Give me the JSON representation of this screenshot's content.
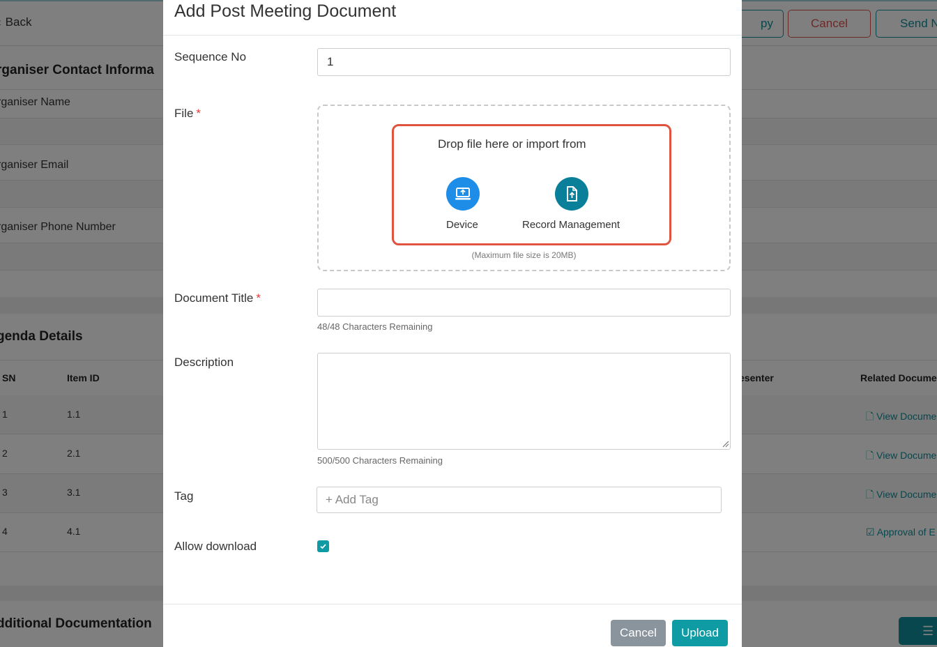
{
  "background": {
    "back_label": "Back",
    "top_buttons": {
      "copy": "py",
      "cancel": "Cancel",
      "send": "Send N"
    },
    "organiser": {
      "section_title": "rganiser Contact Informa",
      "name_label": "rganiser Name",
      "email_label": "rganiser Email",
      "phone_label": "rganiser Phone Number"
    },
    "agenda": {
      "section_title": "genda Details",
      "columns": {
        "sn": "SN",
        "item_id": "Item ID",
        "presenter": "esenter",
        "related_docs": "Related Docume"
      },
      "rows": [
        {
          "sn": "1",
          "item_id": "1.1",
          "doc": "View Docume"
        },
        {
          "sn": "2",
          "item_id": "2.1",
          "doc": "View Docume"
        },
        {
          "sn": "3",
          "item_id": "3.1",
          "doc": "View Docume"
        },
        {
          "sn": "4",
          "item_id": "4.1",
          "doc": "Approval of E"
        }
      ]
    },
    "additional_title": "dditional Documentation"
  },
  "modal": {
    "title": "Add Post Meeting Document",
    "sequence": {
      "label": "Sequence No",
      "value": "1"
    },
    "file": {
      "label": "File",
      "required_mark": "*",
      "drop_text": "Drop file here or import from",
      "device_label": "Device",
      "record_label": "Record Management",
      "max_size": "(Maximum file size is 20MB)"
    },
    "document_title": {
      "label": "Document Title",
      "required_mark": "*",
      "value": "",
      "remaining": "48/48 Characters Remaining"
    },
    "description": {
      "label": "Description",
      "value": "",
      "remaining": "500/500 Characters Remaining"
    },
    "tag": {
      "label": "Tag",
      "placeholder": "+ Add Tag"
    },
    "allow_download": {
      "label": "Allow download",
      "checked": true
    },
    "buttons": {
      "cancel": "Cancel",
      "upload": "Upload"
    }
  },
  "colors": {
    "accent": "#0e9ba4",
    "device_icon": "#1e8de8",
    "record_icon": "#0a7f99",
    "highlight": "#e0533f",
    "required": "#e53935"
  }
}
